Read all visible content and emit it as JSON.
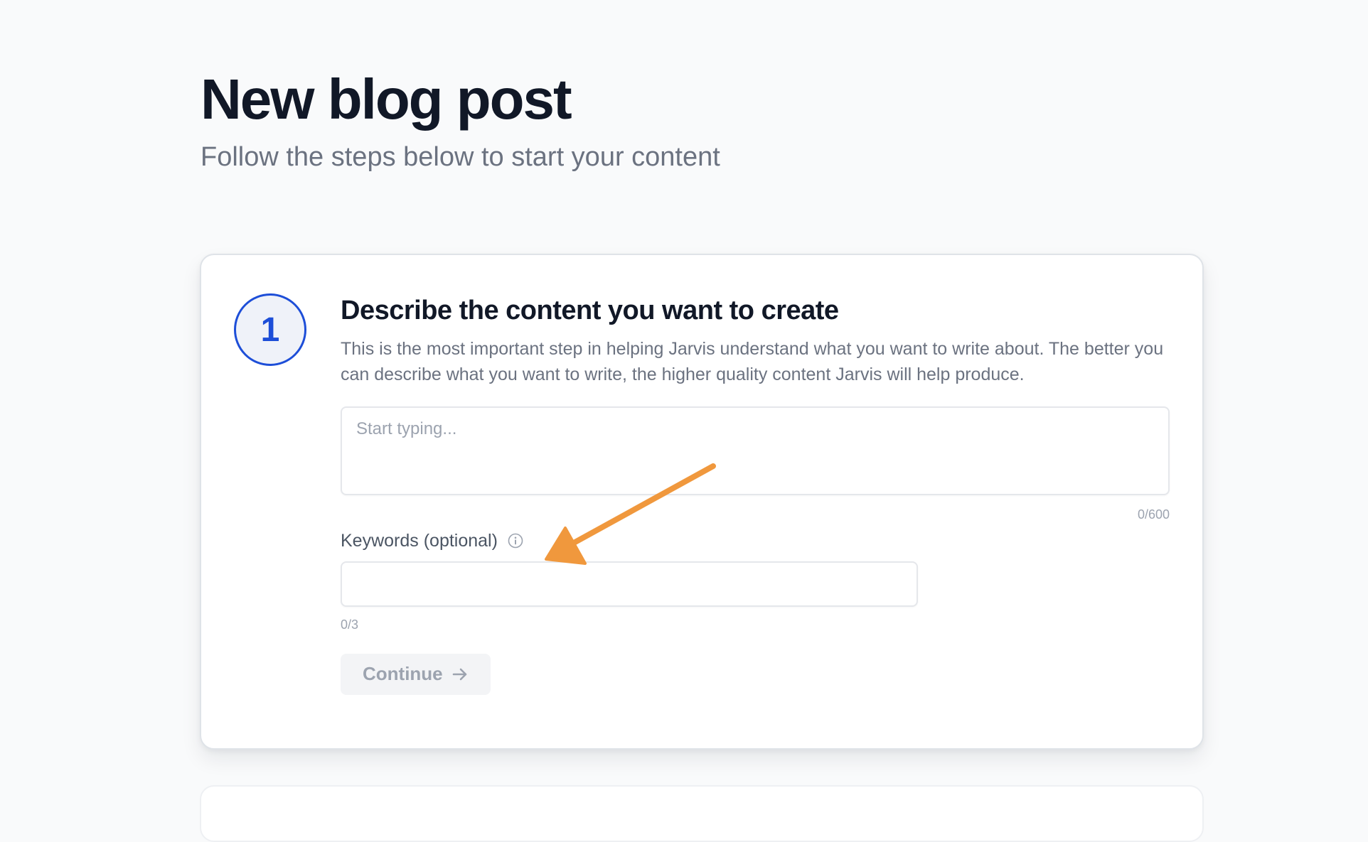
{
  "header": {
    "title": "New blog post",
    "subtitle": "Follow the steps below to start your content"
  },
  "step": {
    "number": "1",
    "title": "Describe the content you want to create",
    "description": "This is the most important step in helping Jarvis understand what you want to write about. The better you can describe what you want to write, the higher quality content Jarvis will help produce.",
    "textarea": {
      "value": "",
      "placeholder": "Start typing...",
      "char_count": "0/600"
    },
    "keywords": {
      "label": "Keywords (optional)",
      "value": "",
      "count": "0/3"
    },
    "continue_label": "Continue"
  },
  "colors": {
    "accent": "#1d4ed8",
    "annotation_arrow": "#f0983d",
    "title_text": "#111827",
    "muted_text": "#6b7280"
  },
  "icons": {
    "step_badge": "circle-number",
    "keywords_info": "info-icon",
    "continue": "arrow-right-icon",
    "annotation": "arrow-annotation-icon"
  },
  "button_state": {
    "continue_disabled": true
  }
}
